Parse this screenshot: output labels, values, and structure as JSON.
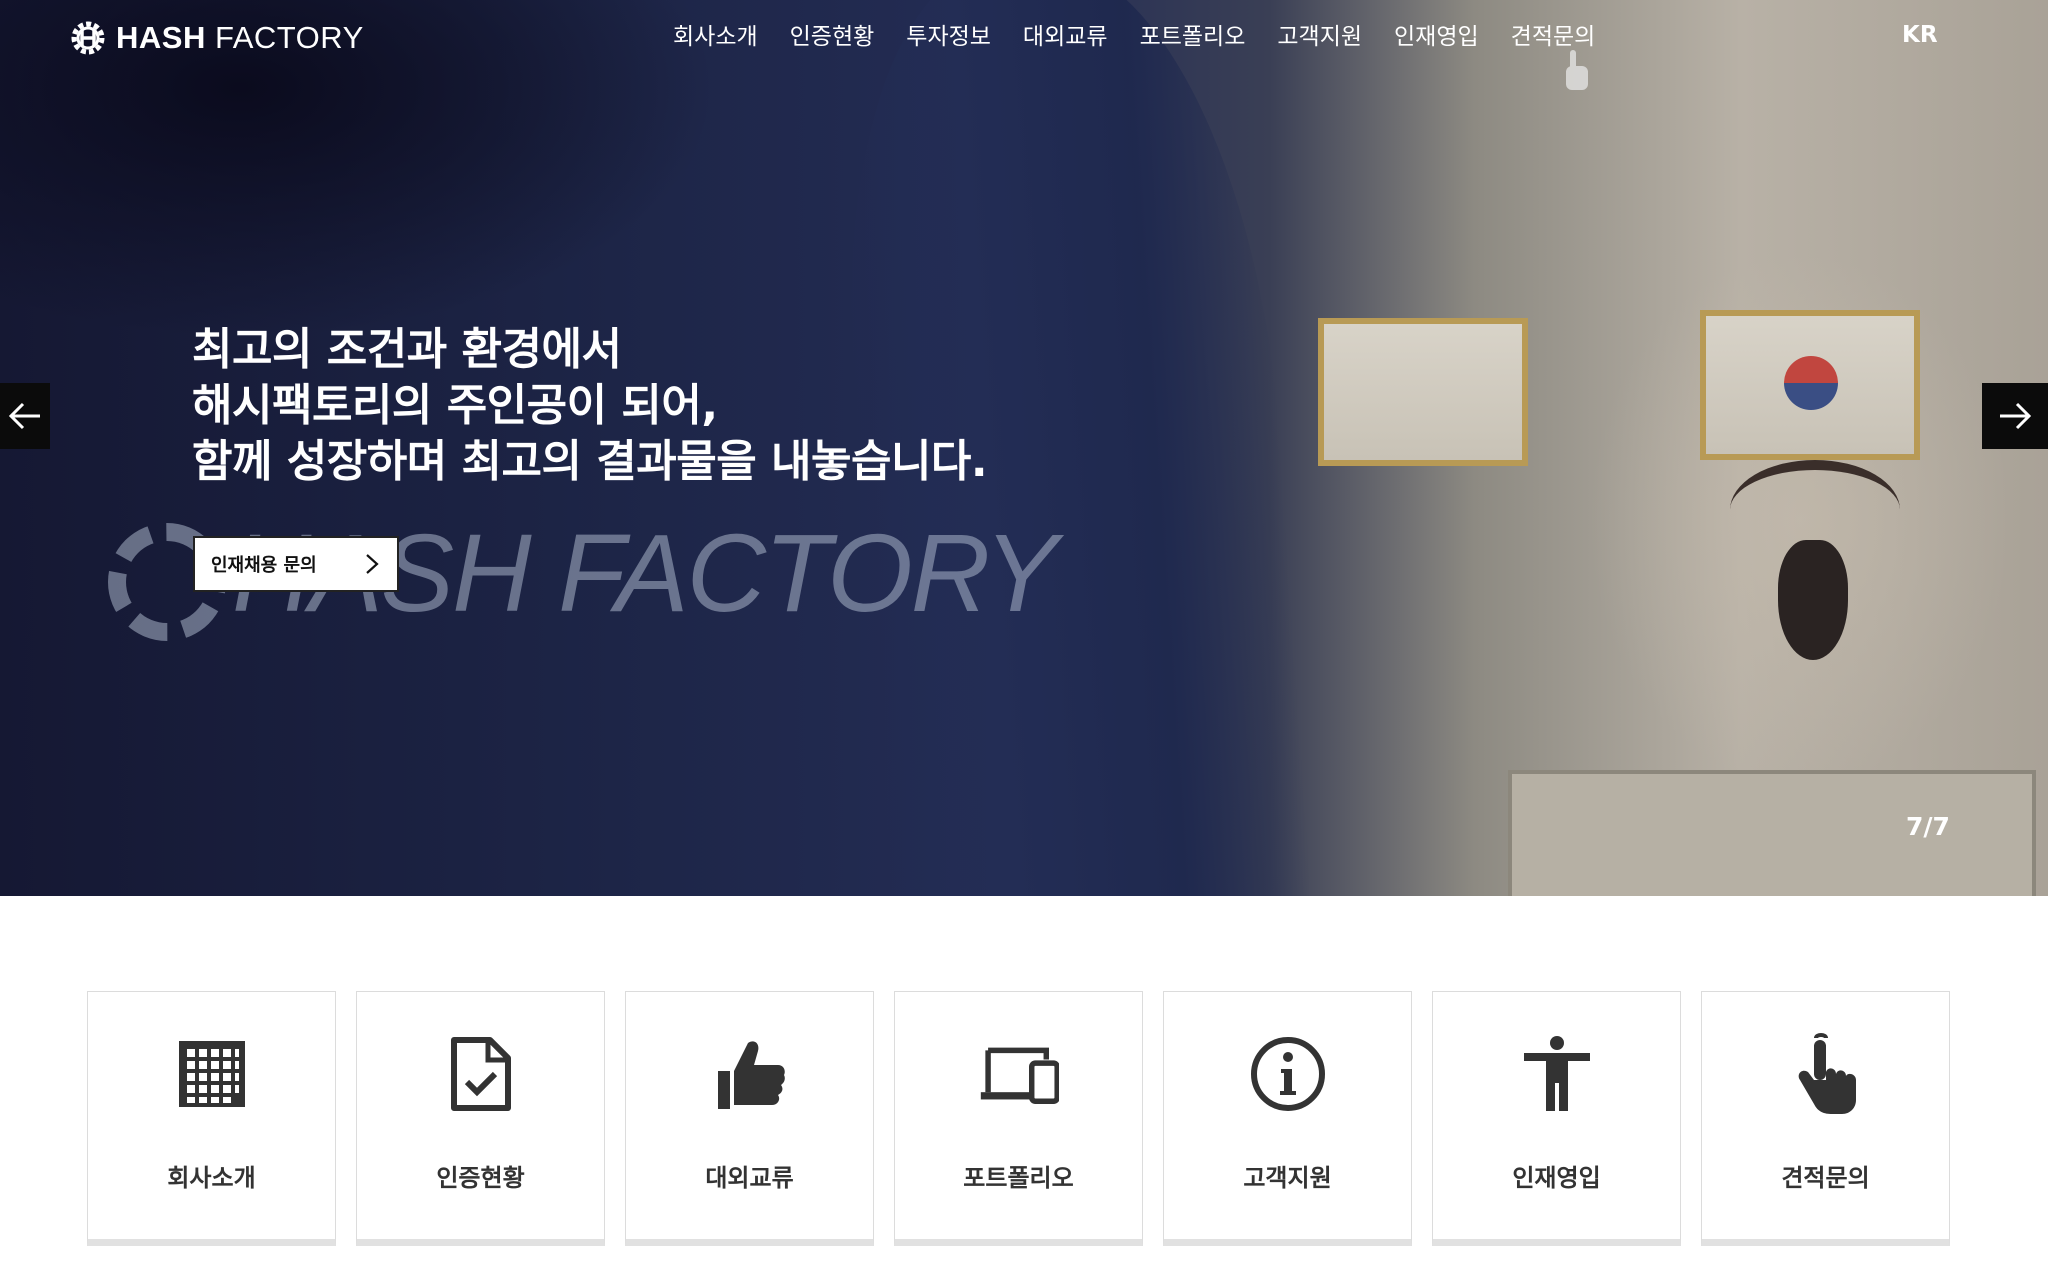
{
  "brand": {
    "name_bold": "HASH",
    "name_light": "FACTORY"
  },
  "nav": {
    "items": [
      {
        "label": "회사소개"
      },
      {
        "label": "인증현황"
      },
      {
        "label": "투자정보"
      },
      {
        "label": "대외교류"
      },
      {
        "label": "포트폴리오"
      },
      {
        "label": "고객지원"
      },
      {
        "label": "인재영입"
      },
      {
        "label": "견적문의"
      }
    ],
    "language": "KR"
  },
  "hero": {
    "headline_lines": [
      "최고의 조건과 환경에서",
      "해시팩토리의 주인공이 되어,",
      "함께 성장하며 최고의 결과물을 내놓습니다."
    ],
    "button_label": "인재채용 문의",
    "background_text": "HASH FACTORY",
    "slide_counter": "7/7",
    "current_slide": 7,
    "total_slides": 7
  },
  "cards": [
    {
      "label": "회사소개",
      "icon": "building-icon"
    },
    {
      "label": "인증현황",
      "icon": "document-check-icon"
    },
    {
      "label": "대외교류",
      "icon": "thumbs-up-icon"
    },
    {
      "label": "포트폴리오",
      "icon": "devices-icon"
    },
    {
      "label": "고객지원",
      "icon": "info-circle-icon"
    },
    {
      "label": "인재영입",
      "icon": "person-icon"
    },
    {
      "label": "견적문의",
      "icon": "pointer-hand-icon"
    }
  ],
  "colors": {
    "icon": "#333333",
    "card_border": "#dcdcdc",
    "arrow_bg": "#0b0b0b"
  }
}
